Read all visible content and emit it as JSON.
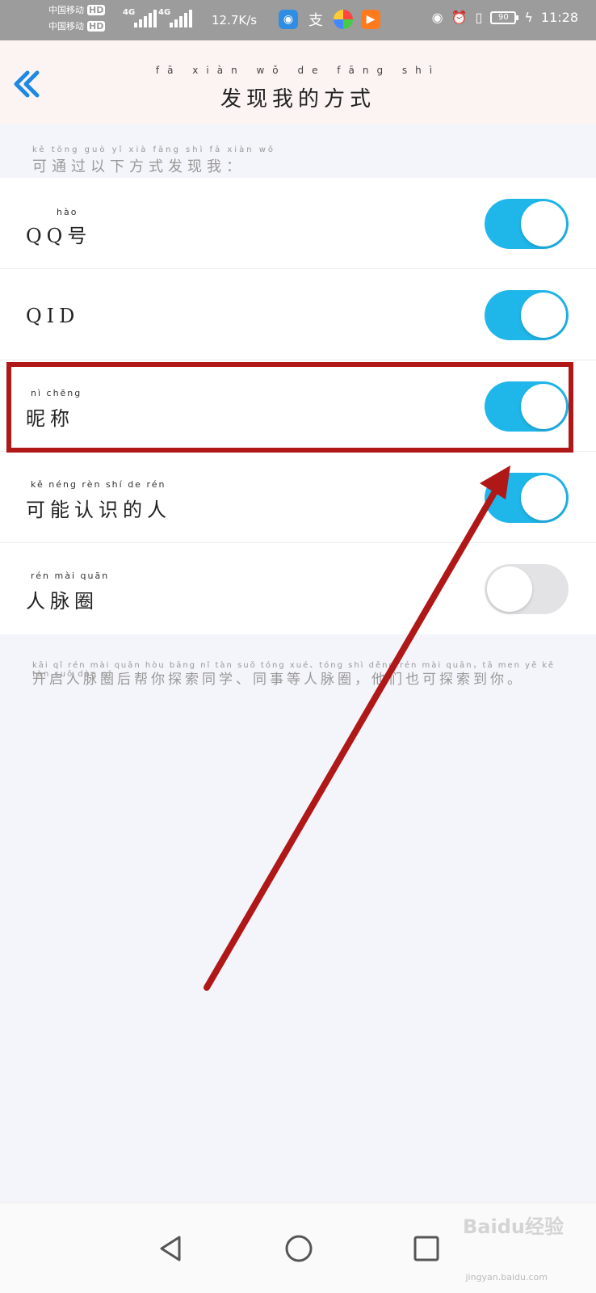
{
  "status_bar": {
    "carrier1": "中国移动",
    "carrier2": "中国移动",
    "hd": "HD",
    "net1": "4G",
    "net2": "4G",
    "speed": "12.7K/s",
    "app_zhi": "支",
    "battery": "90",
    "time": "11:28"
  },
  "header": {
    "title_pinyin": "fā xiàn wǒ de fāng shì",
    "title": "发现我的方式"
  },
  "section": {
    "hint_pinyin": "kě tōng guò yǐ xià fāng shì fā xiàn wǒ",
    "hint": "可通过以下方式发现我："
  },
  "options": [
    {
      "pinyin": "hào",
      "label": "QQ号",
      "enabled": true
    },
    {
      "pinyin": "",
      "label": "QID",
      "enabled": true
    },
    {
      "pinyin": "nì chēng",
      "label": "昵称",
      "enabled": true
    },
    {
      "pinyin": "kě néng rèn shí de rén",
      "label": "可能认识的人",
      "enabled": true
    },
    {
      "pinyin": "rén mài quān",
      "label": "人脉圈",
      "enabled": false
    }
  ],
  "note": {
    "pinyin": "kāi qǐ rén mài quān hòu bāng nǐ tàn suǒ tóng xué、tóng shì děng rén mài quān，tā men yě kě tàn suǒ dào nǐ",
    "text": "开启人脉圈后帮你探索同学、同事等人脉圈，他们也可探索到你。"
  },
  "watermark": {
    "brand": "Baidu经验",
    "sub": "jingyan.baidu.com"
  },
  "colors": {
    "toggle_on": "#1fb6ea",
    "toggle_off": "#e3e3e6",
    "accent": "#1e88e5",
    "annotation": "#b01717"
  }
}
